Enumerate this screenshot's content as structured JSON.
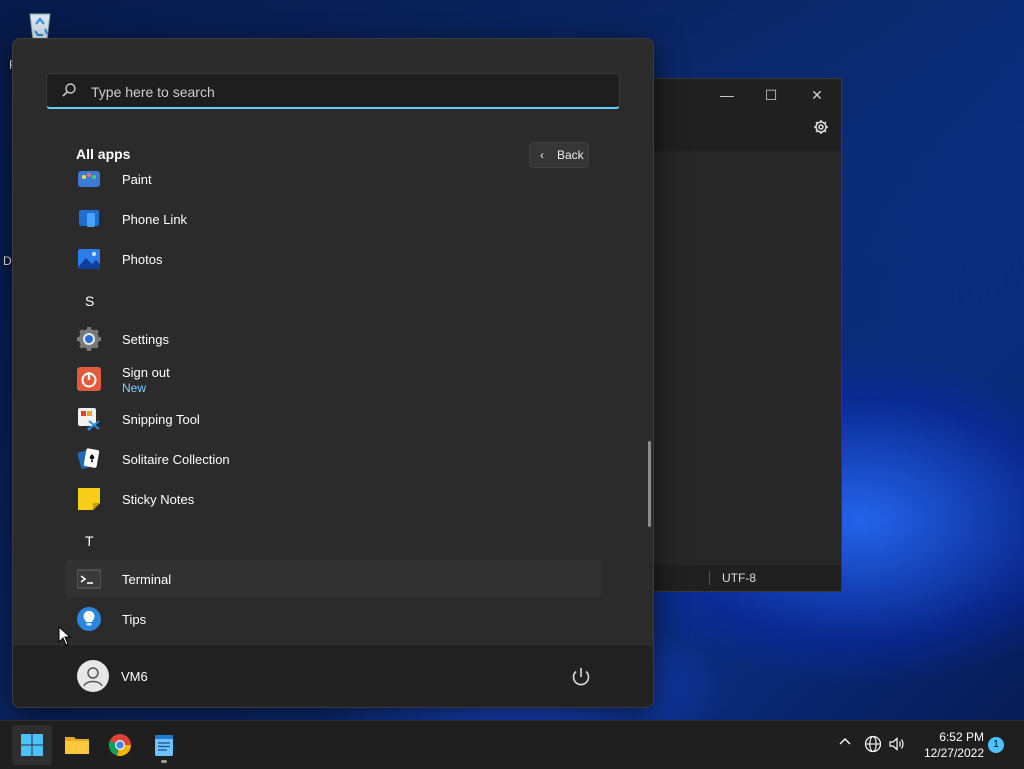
{
  "desktop": {
    "recycle_bin_label_fragment": "R",
    "second_icon_label_fragment": "Da"
  },
  "background_window": {
    "minimize_glyph": "—",
    "maximize_glyph": "☐",
    "close_glyph": "✕",
    "settings_icon": "gear-icon",
    "encoding": "UTF-8"
  },
  "start_menu": {
    "search_placeholder": "Type here to search",
    "all_apps_title": "All apps",
    "back_label": "Back",
    "apps": [
      {
        "label": "Paint",
        "icon": "paint-icon"
      },
      {
        "label": "Phone Link",
        "icon": "phone-link-icon"
      },
      {
        "label": "Photos",
        "icon": "photos-icon"
      },
      {
        "letter": "S"
      },
      {
        "label": "Settings",
        "icon": "settings-icon"
      },
      {
        "label": "Sign out",
        "sublabel": "New",
        "icon": "sign-out-icon"
      },
      {
        "label": "Snipping Tool",
        "icon": "snipping-tool-icon"
      },
      {
        "label": "Solitaire Collection",
        "icon": "solitaire-icon"
      },
      {
        "label": "Sticky Notes",
        "icon": "sticky-notes-icon"
      },
      {
        "letter": "T"
      },
      {
        "label": "Terminal",
        "icon": "terminal-icon"
      },
      {
        "label": "Tips",
        "icon": "tips-icon"
      }
    ],
    "user_name": "VM6"
  },
  "taskbar": {
    "apps": [
      "start-icon",
      "file-explorer-icon",
      "chrome-icon",
      "notepad-icon"
    ],
    "time": "6:52 PM",
    "date": "12/27/2022",
    "notification_count": "1"
  },
  "colors": {
    "accent": "#60cdff",
    "menu_bg": "#2b2b2b",
    "taskbar_bg": "#1f1f1f"
  }
}
